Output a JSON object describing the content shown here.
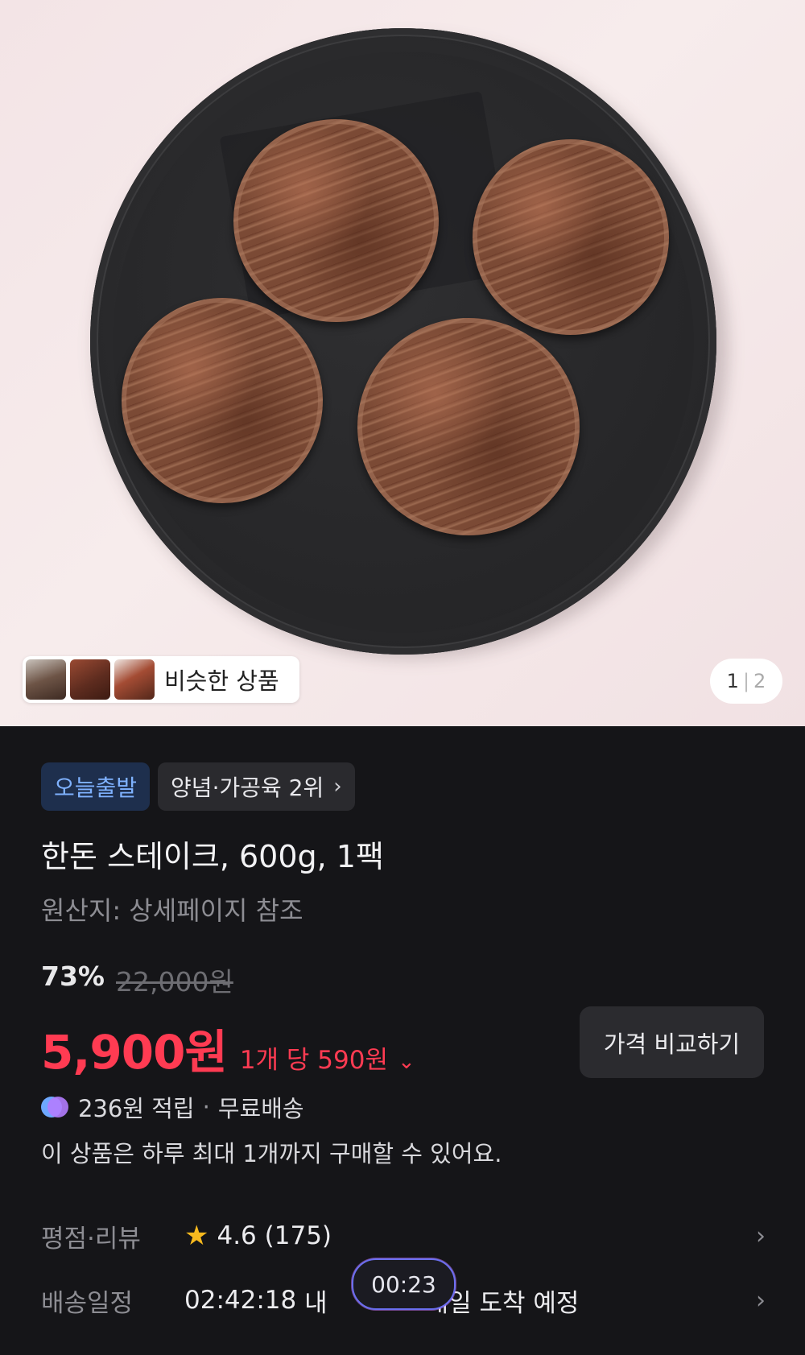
{
  "hero": {
    "similar_label": "비슷한 상품",
    "counter_current": "1",
    "counter_total": "2"
  },
  "badges": {
    "today_ship": "오늘출발",
    "rank": "양념·가공육 2위"
  },
  "product": {
    "title": "한돈 스테이크, 600g, 1팩",
    "origin": "원산지: 상세페이지 참조",
    "discount_pct": "73%",
    "original_price": "22,000원",
    "price": "5,900원",
    "unit_price": "1개 당 590원",
    "compare_button": "가격 비교하기",
    "points": "236원 적립",
    "shipping": "무료배송",
    "limit_note": "이 상품은 하루 최대 1개까지 구매할 수 있어요."
  },
  "rating": {
    "label": "평점·리뷰",
    "score": "4.6",
    "count": "(175)"
  },
  "delivery": {
    "label": "배송일정",
    "countdown": "02:42:18",
    "text_before": "내",
    "text_after": "내일 도착 예정"
  },
  "overlay": {
    "timer": "00:23"
  },
  "colors": {
    "accent_red": "#ff3b52",
    "badge_blue_text": "#7fb2ff",
    "star": "#f7b91e"
  }
}
